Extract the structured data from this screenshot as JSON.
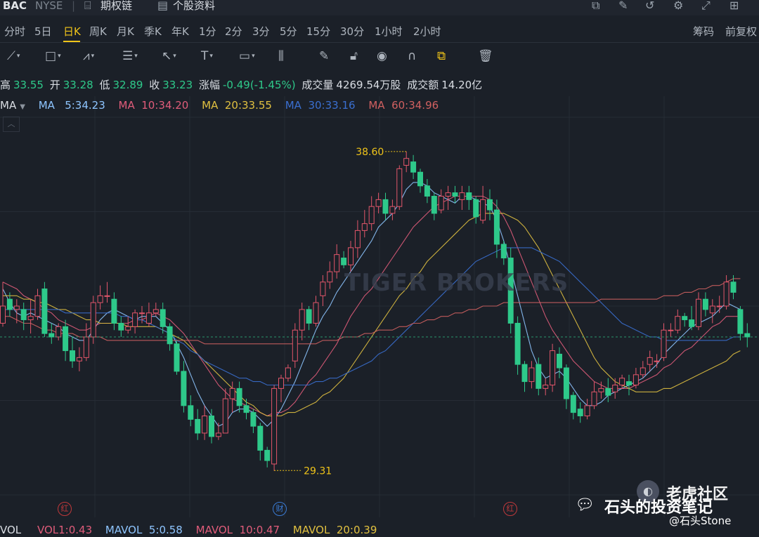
{
  "header": {
    "ticker": "BAC",
    "exchange": "NYSE",
    "options_link": "期权链",
    "profile_link": "个股资料"
  },
  "timeframes": [
    "分时",
    "5日",
    "日K",
    "周K",
    "月K",
    "季K",
    "年K",
    "1分",
    "2分",
    "3分",
    "5分",
    "15分",
    "30分",
    "1小时",
    "2小时"
  ],
  "active_timeframe": "日K",
  "right_tabs": [
    "筹码",
    "前复权"
  ],
  "quote": {
    "high_label": "高",
    "high": "33.55",
    "open_label": "开",
    "open": "33.28",
    "low_label": "低",
    "low": "32.89",
    "close_label": "收",
    "close": "33.23",
    "change_label": "涨幅",
    "change": "-0.49(-1.45%)",
    "volume_label": "成交量",
    "volume": "4269.54万股",
    "turnover_label": "成交额",
    "turnover": "14.20亿"
  },
  "ma_labels": {
    "title": "MA",
    "ma5": "MA   5:34.23",
    "ma10": "MA  10:34.20",
    "ma20": "MA  20:33.55",
    "ma30": "MA  30:33.16",
    "ma60": "MA  60:34.96"
  },
  "chart_annotations": {
    "high": "38.60",
    "low": "29.31"
  },
  "event_markers": [
    "红",
    "财",
    "红"
  ],
  "vol": {
    "title": "VOL",
    "vol1": "VOL1:0.43",
    "mavol5": "MAVOL  5:0.58",
    "mavol10": "MAVOL  10:0.47",
    "mavol20": "MAVOL  20:0.39"
  },
  "watermark": {
    "brand": "TIGER BROKERS",
    "community": "老虎社区",
    "account": "石头的投资笔记",
    "handle": "@石头Stone"
  },
  "colors": {
    "up": "#e2566a",
    "down": "#2ec98a",
    "ma5": "#8ec5ff",
    "ma10": "#e05c7a",
    "ma20": "#e0c040",
    "ma30": "#3a6fd0",
    "ma60": "#d06060",
    "accent": "#f0c419"
  },
  "chart_data": {
    "type": "candlestick",
    "y_range": [
      28.6,
      39.6
    ],
    "annotations": [
      {
        "label": "38.60",
        "value": 38.6
      },
      {
        "label": "29.31",
        "value": 29.31
      }
    ],
    "candles": [
      [
        33.6,
        34.1,
        33.5,
        34.8
      ],
      [
        34.3,
        34.0,
        33.8,
        34.5
      ],
      [
        34.0,
        34.1,
        33.6,
        34.3
      ],
      [
        34.0,
        33.7,
        33.4,
        34.2
      ],
      [
        33.7,
        33.8,
        33.3,
        34.3
      ],
      [
        33.8,
        34.4,
        33.7,
        34.6
      ],
      [
        34.6,
        33.3,
        33.2,
        34.8
      ],
      [
        33.3,
        33.2,
        33.0,
        33.6
      ],
      [
        33.2,
        33.5,
        33.1,
        33.6
      ],
      [
        33.5,
        32.8,
        32.5,
        33.7
      ],
      [
        32.8,
        32.5,
        32.3,
        33.2
      ],
      [
        32.5,
        32.6,
        32.2,
        32.9
      ],
      [
        32.6,
        33.2,
        32.5,
        33.6
      ],
      [
        33.2,
        34.2,
        33.0,
        34.4
      ],
      [
        34.2,
        34.4,
        34.0,
        34.7
      ],
      [
        34.4,
        34.4,
        34.2,
        34.8
      ],
      [
        34.3,
        33.6,
        33.4,
        34.5
      ],
      [
        33.6,
        33.4,
        33.2,
        33.8
      ],
      [
        33.4,
        33.5,
        33.3,
        33.8
      ],
      [
        33.5,
        33.9,
        33.3,
        34.0
      ],
      [
        33.9,
        33.9,
        33.6,
        34.1
      ],
      [
        33.6,
        33.9,
        33.5,
        34.2
      ],
      [
        33.9,
        34.0,
        33.8,
        34.2
      ],
      [
        34.0,
        33.5,
        33.3,
        34.2
      ],
      [
        33.5,
        33.0,
        32.8,
        33.6
      ],
      [
        33.0,
        32.2,
        32.1,
        33.1
      ],
      [
        32.2,
        31.2,
        31.0,
        32.5
      ],
      [
        31.2,
        30.8,
        30.6,
        31.5
      ],
      [
        30.8,
        30.4,
        30.2,
        31.1
      ],
      [
        30.4,
        30.9,
        30.2,
        31.2
      ],
      [
        30.9,
        30.3,
        30.1,
        31.1
      ],
      [
        30.3,
        30.4,
        30.2,
        30.7
      ],
      [
        30.4,
        31.4,
        30.6,
        31.7
      ],
      [
        31.4,
        31.7,
        31.0,
        31.9
      ],
      [
        31.7,
        31.2,
        31.0,
        31.9
      ],
      [
        31.2,
        31.0,
        30.8,
        31.4
      ],
      [
        31.0,
        30.6,
        30.4,
        31.1
      ],
      [
        30.6,
        29.9,
        29.6,
        30.7
      ],
      [
        29.9,
        29.6,
        29.4,
        30.0
      ],
      [
        29.5,
        31.7,
        29.3,
        31.8
      ],
      [
        31.7,
        32.0,
        31.3,
        32.1
      ],
      [
        32.0,
        32.3,
        31.9,
        32.4
      ],
      [
        32.5,
        33.4,
        32.3,
        33.6
      ],
      [
        33.4,
        34.0,
        33.1,
        34.2
      ],
      [
        34.0,
        33.6,
        33.4,
        34.1
      ],
      [
        33.6,
        34.2,
        33.5,
        34.4
      ],
      [
        34.4,
        34.8,
        34.1,
        35.0
      ],
      [
        34.8,
        35.1,
        34.6,
        35.4
      ],
      [
        35.1,
        35.6,
        34.9,
        35.9
      ],
      [
        35.5,
        35.3,
        35.2,
        35.7
      ],
      [
        35.3,
        35.8,
        35.1,
        36.0
      ],
      [
        35.8,
        36.3,
        35.5,
        36.6
      ],
      [
        36.3,
        36.5,
        36.1,
        36.9
      ],
      [
        36.5,
        37.0,
        36.3,
        37.3
      ],
      [
        37.0,
        37.2,
        36.8,
        37.4
      ],
      [
        37.2,
        36.8,
        36.6,
        37.4
      ],
      [
        36.8,
        37.0,
        36.6,
        37.2
      ],
      [
        37.0,
        38.1,
        36.9,
        38.2
      ],
      [
        38.2,
        38.4,
        38.0,
        38.6
      ],
      [
        38.3,
        38.0,
        37.8,
        38.5
      ],
      [
        38.0,
        37.6,
        37.4,
        38.1
      ],
      [
        37.6,
        37.3,
        37.1,
        37.8
      ],
      [
        37.3,
        36.8,
        36.6,
        37.4
      ],
      [
        36.9,
        37.3,
        36.8,
        37.5
      ],
      [
        37.3,
        37.4,
        36.9,
        37.6
      ],
      [
        37.4,
        37.3,
        37.1,
        37.6
      ],
      [
        37.2,
        37.4,
        36.9,
        37.6
      ],
      [
        37.4,
        37.2,
        36.9,
        37.6
      ],
      [
        37.2,
        36.7,
        36.5,
        37.3
      ],
      [
        36.6,
        37.2,
        36.5,
        37.6
      ],
      [
        37.2,
        36.9,
        36.6,
        37.5
      ],
      [
        36.9,
        35.9,
        35.5,
        37.2
      ],
      [
        35.9,
        35.5,
        35.3,
        36.0
      ],
      [
        35.5,
        33.6,
        33.3,
        35.8
      ],
      [
        33.6,
        32.4,
        32.1,
        33.8
      ],
      [
        32.4,
        31.9,
        31.6,
        32.5
      ],
      [
        31.9,
        32.3,
        31.7,
        32.5
      ],
      [
        32.4,
        31.7,
        31.5,
        32.6
      ],
      [
        31.7,
        31.8,
        31.5,
        32.0
      ],
      [
        31.8,
        32.8,
        31.6,
        33.0
      ],
      [
        32.7,
        32.3,
        32.0,
        32.9
      ],
      [
        32.3,
        31.4,
        31.1,
        32.4
      ],
      [
        31.5,
        31.0,
        30.8,
        31.6
      ],
      [
        31.1,
        30.9,
        30.7,
        31.3
      ],
      [
        30.9,
        31.2,
        30.8,
        31.4
      ],
      [
        31.2,
        31.6,
        31.1,
        31.9
      ],
      [
        31.6,
        31.7,
        31.4,
        31.9
      ],
      [
        31.7,
        31.5,
        31.3,
        32.0
      ],
      [
        31.6,
        31.8,
        31.4,
        32.0
      ],
      [
        31.8,
        32.0,
        31.7,
        32.1
      ],
      [
        31.9,
        31.8,
        31.5,
        32.1
      ],
      [
        31.8,
        32.1,
        31.7,
        32.3
      ],
      [
        32.1,
        32.3,
        32.0,
        32.5
      ],
      [
        32.4,
        32.6,
        32.2,
        32.8
      ],
      [
        32.5,
        32.5,
        32.3,
        32.7
      ],
      [
        32.6,
        33.4,
        32.5,
        33.6
      ],
      [
        33.4,
        33.4,
        33.2,
        33.6
      ],
      [
        33.4,
        33.8,
        33.3,
        34.0
      ],
      [
        33.8,
        33.7,
        33.5,
        33.9
      ],
      [
        33.7,
        33.5,
        33.4,
        34.1
      ],
      [
        33.5,
        34.3,
        33.4,
        34.5
      ],
      [
        34.3,
        34.0,
        33.8,
        34.5
      ],
      [
        33.9,
        34.1,
        33.6,
        34.3
      ],
      [
        34.1,
        34.1,
        33.9,
        34.4
      ],
      [
        34.1,
        34.8,
        34.0,
        35.0
      ],
      [
        34.8,
        34.5,
        34.3,
        35.0
      ],
      [
        34.0,
        33.3,
        33.1,
        34.1
      ],
      [
        33.3,
        33.2,
        32.9,
        33.6
      ]
    ],
    "series": [
      {
        "name": "MA5",
        "color": "#8ec5ff",
        "values": [
          34.6,
          34.2,
          33.9,
          33.8,
          33.9,
          33.8,
          33.7,
          33.6,
          33.5,
          33.3,
          33.2,
          33.1,
          33.1,
          33.4,
          33.7,
          33.9,
          34.0,
          33.9,
          33.8,
          33.7,
          33.8,
          33.8,
          33.8,
          33.6,
          33.4,
          33.0,
          32.6,
          32.1,
          31.6,
          31.2,
          30.9,
          30.6,
          30.7,
          31.0,
          31.1,
          31.1,
          31.0,
          30.8,
          30.6,
          30.8,
          31.1,
          31.5,
          31.9,
          32.4,
          32.9,
          33.4,
          33.8,
          34.1,
          34.5,
          34.8,
          35.1,
          35.4,
          35.7,
          36.0,
          36.4,
          36.6,
          36.8,
          37.1,
          37.5,
          37.7,
          37.7,
          37.6,
          37.4,
          37.3,
          37.2,
          37.1,
          37.3,
          37.3,
          37.2,
          37.1,
          37.0,
          36.6,
          36.0,
          35.2,
          34.4,
          33.6,
          32.8,
          32.3,
          32.0,
          32.1,
          32.2,
          32.0,
          31.7,
          31.4,
          31.2,
          31.2,
          31.3,
          31.5,
          31.6,
          31.7,
          31.8,
          31.9,
          32.0,
          32.2,
          32.4,
          32.7,
          32.9,
          33.1,
          33.3,
          33.5,
          33.6,
          33.7,
          33.8,
          34.0,
          34.2,
          34.1,
          34.0
        ]
      },
      {
        "name": "MA10",
        "color": "#e05c7a",
        "values": [
          34.8,
          34.7,
          34.6,
          34.4,
          34.3,
          34.2,
          34.0,
          33.9,
          33.7,
          33.6,
          33.5,
          33.4,
          33.4,
          33.5,
          33.6,
          33.6,
          33.6,
          33.6,
          33.6,
          33.7,
          33.7,
          33.8,
          33.9,
          33.8,
          33.7,
          33.5,
          33.3,
          33.0,
          32.7,
          32.4,
          32.1,
          31.8,
          31.6,
          31.4,
          31.3,
          31.2,
          31.1,
          31.0,
          30.9,
          31.0,
          31.0,
          31.1,
          31.3,
          31.6,
          31.9,
          32.1,
          32.4,
          32.7,
          33.0,
          33.4,
          33.8,
          34.1,
          34.4,
          34.6,
          34.9,
          35.2,
          35.5,
          35.8,
          36.1,
          36.4,
          36.6,
          36.8,
          37.0,
          37.1,
          37.2,
          37.3,
          37.3,
          37.3,
          37.3,
          37.3,
          37.2,
          37.0,
          36.7,
          36.3,
          35.8,
          35.3,
          34.8,
          34.3,
          33.8,
          33.4,
          33.1,
          32.8,
          32.5,
          32.3,
          32.1,
          31.9,
          31.8,
          31.7,
          31.7,
          31.7,
          31.7,
          31.8,
          31.9,
          32.0,
          32.1,
          32.3,
          32.4,
          32.6,
          32.8,
          32.9,
          33.1,
          33.3,
          33.5,
          33.6,
          33.8,
          33.8,
          33.8
        ]
      },
      {
        "name": "MA20",
        "color": "#e0c040",
        "values": [
          34.4,
          34.4,
          34.4,
          34.3,
          34.3,
          34.2,
          34.2,
          34.1,
          34.0,
          34.0,
          33.9,
          33.8,
          33.7,
          33.7,
          33.6,
          33.6,
          33.6,
          33.6,
          33.5,
          33.5,
          33.5,
          33.5,
          33.5,
          33.4,
          33.3,
          33.2,
          33.1,
          32.9,
          32.7,
          32.5,
          32.3,
          32.1,
          31.9,
          31.7,
          31.5,
          31.3,
          31.2,
          31.0,
          30.9,
          30.9,
          30.9,
          31.0,
          31.0,
          31.1,
          31.2,
          31.3,
          31.5,
          31.6,
          31.8,
          32.0,
          32.3,
          32.6,
          32.9,
          33.2,
          33.5,
          33.8,
          34.1,
          34.4,
          34.6,
          34.9,
          35.1,
          35.4,
          35.6,
          35.8,
          36.0,
          36.2,
          36.4,
          36.6,
          36.7,
          36.8,
          36.8,
          36.8,
          36.8,
          36.7,
          36.6,
          36.4,
          36.1,
          35.8,
          35.4,
          35.0,
          34.6,
          34.2,
          33.8,
          33.4,
          33.0,
          32.6,
          32.3,
          32.1,
          31.9,
          31.8,
          31.7,
          31.6,
          31.6,
          31.6,
          31.6,
          31.7,
          31.7,
          31.8,
          31.9,
          32.0,
          32.1,
          32.2,
          32.3,
          32.4,
          32.5,
          32.7,
          32.8
        ]
      },
      {
        "name": "MA30",
        "color": "#3a6fd0",
        "values": [
          34.0,
          34.0,
          34.0,
          34.0,
          34.0,
          34.0,
          34.0,
          34.0,
          34.0,
          33.9,
          33.9,
          33.9,
          33.9,
          33.9,
          33.9,
          33.9,
          33.9,
          33.8,
          33.8,
          33.7,
          33.7,
          33.6,
          33.5,
          33.4,
          33.3,
          33.1,
          33.0,
          32.8,
          32.7,
          32.5,
          32.4,
          32.3,
          32.2,
          32.1,
          32.0,
          32.0,
          31.9,
          31.9,
          31.8,
          31.8,
          31.8,
          31.8,
          31.8,
          31.8,
          31.8,
          31.9,
          31.9,
          32.0,
          32.0,
          32.1,
          32.2,
          32.3,
          32.4,
          32.5,
          32.7,
          32.8,
          33.0,
          33.2,
          33.4,
          33.6,
          33.8,
          34.0,
          34.2,
          34.4,
          34.6,
          34.8,
          35.0,
          35.2,
          35.4,
          35.5,
          35.6,
          35.7,
          35.8,
          35.8,
          35.8,
          35.8,
          35.8,
          35.7,
          35.6,
          35.5,
          35.4,
          35.2,
          35.0,
          34.8,
          34.6,
          34.4,
          34.2,
          34.0,
          33.8,
          33.6,
          33.5,
          33.4,
          33.3,
          33.2,
          33.2,
          33.1,
          33.1,
          33.1,
          33.1,
          33.1,
          33.1,
          33.1,
          33.1,
          33.1,
          33.1,
          33.2,
          33.2
        ]
      },
      {
        "name": "MA60",
        "color": "#d06060",
        "values": [
          33.8,
          33.8,
          33.7,
          33.6,
          33.6,
          33.5,
          33.4,
          33.4,
          33.3,
          33.3,
          33.3,
          33.2,
          33.2,
          33.2,
          33.2,
          33.1,
          33.1,
          33.1,
          33.1,
          33.1,
          33.1,
          33.1,
          33.1,
          33.1,
          33.1,
          33.1,
          33.1,
          33.1,
          33.1,
          33.0,
          33.0,
          33.0,
          33.0,
          33.0,
          33.0,
          33.0,
          33.0,
          33.0,
          33.0,
          33.0,
          33.0,
          33.0,
          33.0,
          33.0,
          33.0,
          33.0,
          33.1,
          33.1,
          33.1,
          33.2,
          33.2,
          33.2,
          33.3,
          33.3,
          33.4,
          33.4,
          33.4,
          33.5,
          33.5,
          33.6,
          33.6,
          33.7,
          33.7,
          33.8,
          33.8,
          33.9,
          33.9,
          34.0,
          34.0,
          34.1,
          34.1,
          34.1,
          34.2,
          34.2,
          34.2,
          34.2,
          34.2,
          34.2,
          34.2,
          34.2,
          34.2,
          34.2,
          34.2,
          34.2,
          34.2,
          34.2,
          34.3,
          34.3,
          34.3,
          34.3,
          34.3,
          34.3,
          34.3,
          34.3,
          34.3,
          34.4,
          34.4,
          34.4,
          34.5,
          34.5,
          34.6,
          34.6,
          34.7,
          34.7,
          34.8,
          34.9,
          34.9
        ]
      }
    ]
  }
}
